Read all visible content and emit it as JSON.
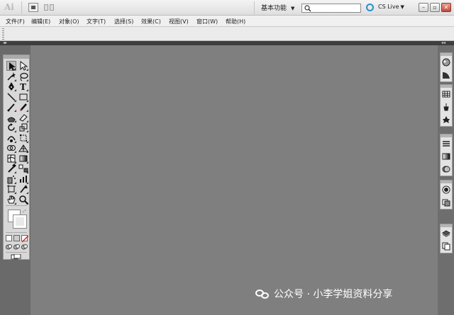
{
  "titlebar": {
    "app_logo": "Ai",
    "workspace_label": "基本功能",
    "search_value": "",
    "cs_live_label": "CS Live",
    "minimize_icon": "minimize-icon",
    "restore_icon": "restore-icon",
    "close_icon": "close-icon"
  },
  "menu": {
    "items": [
      "文件(F)",
      "编辑(E)",
      "对象(O)",
      "文字(T)",
      "选择(S)",
      "效果(C)",
      "视图(V)",
      "窗口(W)",
      "帮助(H)"
    ]
  },
  "toolbox": {
    "tools": [
      "selection-tool-icon",
      "direct-selection-tool-icon",
      "magic-wand-tool-icon",
      "lasso-tool-icon",
      "pen-tool-icon",
      "type-tool-icon",
      "line-segment-tool-icon",
      "rectangle-tool-icon",
      "paintbrush-tool-icon",
      "pencil-tool-icon",
      "blob-brush-tool-icon",
      "eraser-tool-icon",
      "rotate-tool-icon",
      "scale-tool-icon",
      "warp-tool-icon",
      "free-transform-tool-icon",
      "shape-builder-tool-icon",
      "perspective-grid-tool-icon",
      "mesh-tool-icon",
      "gradient-tool-icon",
      "eyedropper-tool-icon",
      "blend-tool-icon",
      "symbol-sprayer-tool-icon",
      "column-graph-tool-icon",
      "artboard-tool-icon",
      "slice-tool-icon",
      "hand-tool-icon",
      "zoom-tool-icon"
    ],
    "fill_color": "#ffffff",
    "stroke_color": "#e9e9e9",
    "color_modes": [
      "color-mode-icon",
      "gradient-mode-icon",
      "none-mode-icon"
    ],
    "draw_modes": [
      "draw-normal-icon",
      "draw-behind-icon",
      "draw-inside-icon"
    ],
    "screen_mode_icon": "screen-mode-icon"
  },
  "right_panels": [
    [
      "color-panel-icon",
      "color-guide-panel-icon"
    ],
    [
      "swatches-panel-icon",
      "brushes-panel-icon",
      "symbols-panel-icon"
    ],
    [
      "stroke-panel-icon",
      "gradient-panel-icon",
      "transparency-panel-icon"
    ],
    [
      "appearance-panel-icon",
      "graphic-styles-panel-icon"
    ],
    [
      "layers-panel-icon",
      "artboards-panel-icon"
    ]
  ],
  "watermark": {
    "text": "公众号 · 小李学姐资料分享"
  },
  "colors": {
    "canvas": "#7f7f7f",
    "cs_live_accent": "#2a8fc8",
    "close_button": "#c24a3a"
  }
}
